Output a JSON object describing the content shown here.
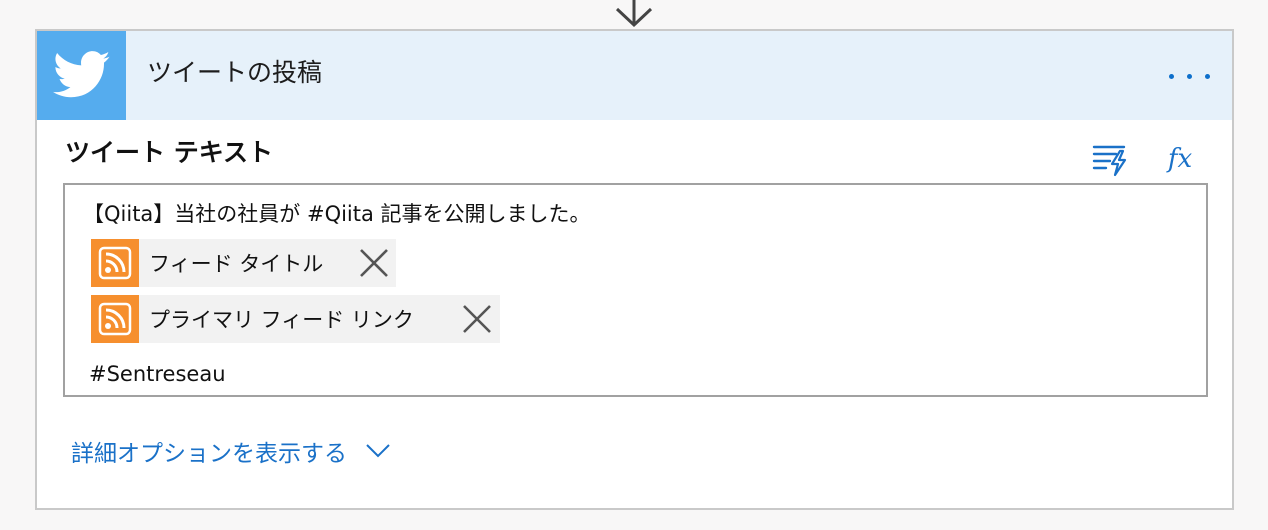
{
  "action": {
    "title": "ツイートの投稿",
    "connector_icon": "twitter-icon",
    "brand_color": "#55acee",
    "header_bg": "#e6f1fa",
    "more_icon": "ellipsis-icon"
  },
  "field": {
    "label": "ツイート テキスト",
    "dynamic_content_icon": "dynamic-content-icon",
    "expression_label": "fx"
  },
  "editor": {
    "line1": "【Qiita】当社の社員が #Qiita 記事を公開しました。",
    "tokens": [
      {
        "label": "フィード タイトル",
        "icon": "rss-icon",
        "remove_icon": "close-icon"
      },
      {
        "label": "プライマリ フィード リンク",
        "icon": "rss-icon",
        "remove_icon": "close-icon"
      }
    ],
    "line4": "#Sentreseau",
    "token_color": "#f68f2e"
  },
  "advanced": {
    "label": "詳細オプションを表示する",
    "accent": "#1a71c8"
  }
}
